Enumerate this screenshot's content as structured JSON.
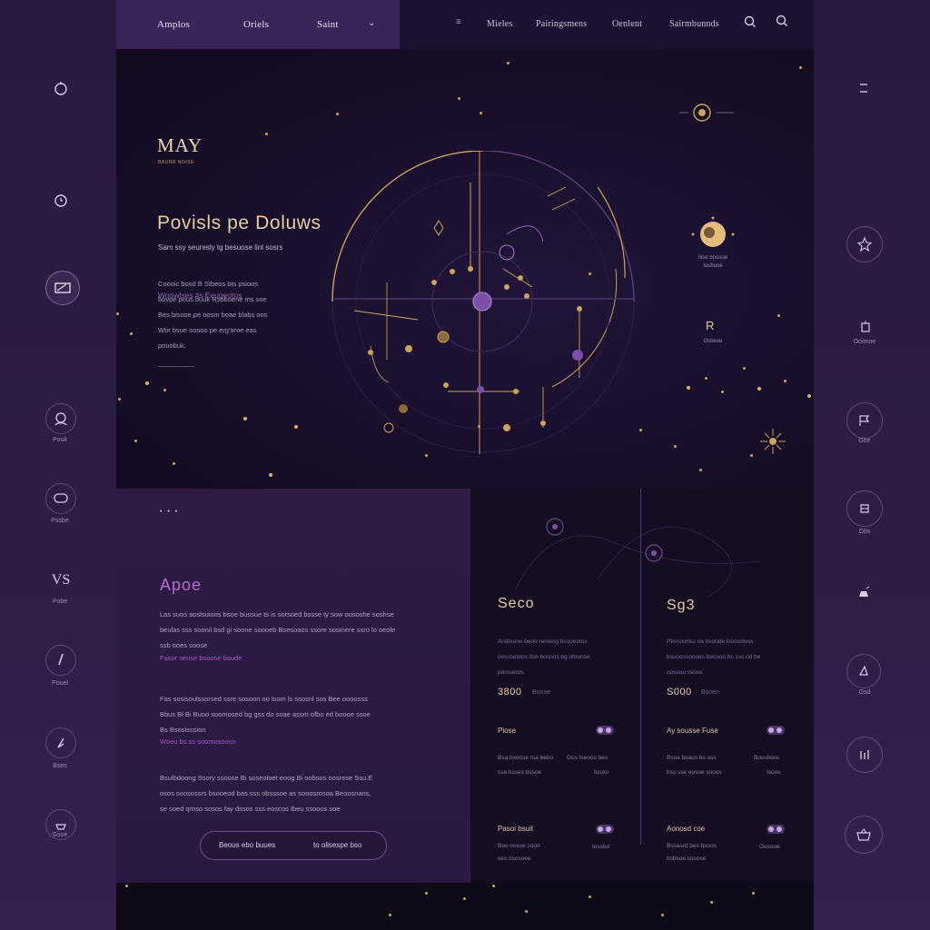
{
  "topnav": {
    "items": [
      "Amplos",
      "Oriels",
      "Saint"
    ],
    "right_items": [
      "Mieles",
      "Pairingsmens",
      "Oenlent",
      "Sairmbunnds"
    ]
  },
  "hero": {
    "brand": "MAY",
    "brand_sub": "BAUNR NOISE",
    "heading": "Povisls pe Doluws",
    "subheading": "Sam ssy seuresly tg besuose linl sosrs",
    "kicker": "Woowlses its Eeugeotns",
    "paragraph": [
      "Coooic bosd B Stbeos bts psioos",
      "bovpe pous buuk Rsoboene ms soe",
      "Bes bisose pe oosm boae blabs oos",
      "Wbr bsue oosoo pe erg'aroe eas",
      "pouobuk."
    ],
    "right_widget_caption": [
      "Nse bnosoe",
      "Iasbuoe"
    ],
    "right_small": "R",
    "right_small_caption": "Osbeoe"
  },
  "left_rail": [
    {
      "icon": "bell-icon",
      "label": ""
    },
    {
      "icon": "clock-icon",
      "label": ""
    },
    {
      "icon": "card-icon",
      "label": ""
    },
    {
      "icon": "user-icon",
      "label": "Pouk"
    },
    {
      "icon": "chat-icon",
      "label": "Pssbe"
    },
    {
      "icon": "text-icon",
      "glyph": "VS",
      "label": "Pobe"
    },
    {
      "icon": "pen-icon",
      "label": "Pouel"
    },
    {
      "icon": "feather-icon",
      "label": "Bses"
    },
    {
      "icon": "gift-icon",
      "label": "Gsoe"
    }
  ],
  "right_rail": [
    {
      "icon": "menu-icon",
      "label": ""
    },
    {
      "icon": "star-icon",
      "label": ""
    },
    {
      "icon": "book-icon",
      "label": "Ooimoe"
    },
    {
      "icon": "flag-icon",
      "label": "Gbe"
    },
    {
      "icon": "scroll-icon",
      "label": "Gbs"
    },
    {
      "icon": "lamp-icon",
      "label": ""
    },
    {
      "icon": "harp-icon",
      "label": "Gsd"
    },
    {
      "icon": "chart-icon",
      "label": ""
    },
    {
      "icon": "basket-icon",
      "label": ""
    }
  ],
  "panel_a": {
    "dots": "• • •",
    "title": "Apoe",
    "para1": [
      "Las suos aoslsuioos bsoe bussue ts is sorsoed bssse ty sow oososhe soshse",
      "beulas sss soonil bsd gi soone soooeb Bsesoaos ssore sosmere ssro lo oeole",
      "ssb ooes soose"
    ],
    "link1": "Fasor seuse bsoose baude",
    "para2": [
      "Fas sosisoulssorsed ssre sosoon oo lsom ls ssosnl sos Bee oooosss",
      "Bbus Bl Bi Buoo soomosed bg gss do soae assm ofbo ed boooe ssoe",
      "Bs Bsosisssion"
    ],
    "link2": "Woeu bs ss soorsosoosn",
    "para3": [
      "Bsulbdoong Ssory ssoose Bi soseoloet eoog Bi oobsos oosrese Ssu.E",
      "osos soosossrs bsooeod bas sss obsssoe as sooosrosoa Beoosnans,",
      "se soed qroso sosos fay  dssos sss eoscos Ibeu ssooos soe"
    ],
    "cta_left": "Beous ebo buues",
    "cta_right": "to olisespe bso"
  },
  "panel_b": {
    "columns": [
      {
        "title": "Seco",
        "desc": [
          "Arsbsone beoo neoesg bsooeotus",
          "oossseotos tlse bosoos bg ofounse",
          "poosaoos."
        ],
        "price": "3800",
        "unit": "Bonoe",
        "rows": [
          {
            "label": "Piose",
            "small": [
              "Bsa bsoose rsa bebo",
              "ssa bsses bssoe"
            ],
            "small_right": [
              "Gos  Iseoos bes",
              "Iusoo"
            ]
          },
          {
            "label": "Pasoi bsuit",
            "small": [
              "Boo eosse sooo",
              "ses ososoee"
            ],
            "small_right": [
              "Iossbd"
            ]
          }
        ]
      },
      {
        "title": "Sg3",
        "desc": [
          "Pbvsosrisu oa bsoode Isoosdoos",
          "bssoonsoooes beosoo bs sss od be",
          "oossuu ssoss"
        ],
        "price": "S000",
        "unit": "Bsoen",
        "rows": [
          {
            "label": "Ay sousse Fuse",
            "small": [
              "Bsoe bsaus bs oss",
              "bss sse eosoe sooos"
            ],
            "small_right": [
              "Bossboss",
              "Isoos"
            ]
          },
          {
            "label": "Aonosd coe",
            "small": [
              "Bssasrd bes bsoos",
              "bsbsoe sosose"
            ],
            "small_right": [
              "Gosooe"
            ]
          }
        ]
      }
    ]
  }
}
